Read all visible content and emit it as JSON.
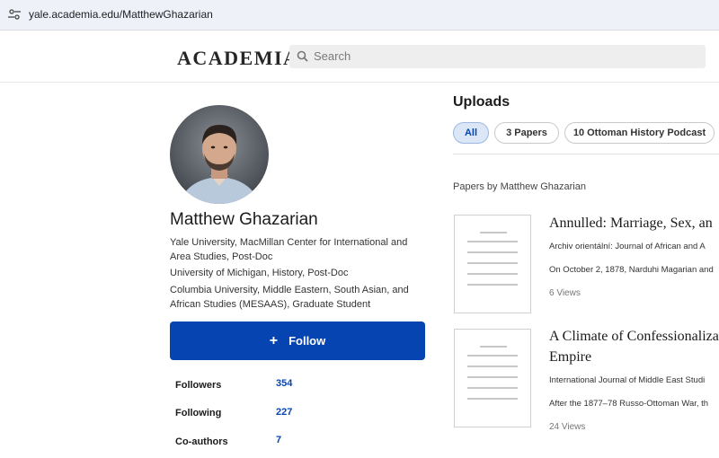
{
  "browser": {
    "url": "yale.academia.edu/MatthewGhazarian"
  },
  "header": {
    "logo": "ACADEMIA",
    "search_placeholder": "Search"
  },
  "profile": {
    "name": "Matthew Ghazarian",
    "affiliations": [
      "Yale University, MacMillan Center for International and Area Studies, Post-Doc",
      "University of Michigan, History, Post-Doc",
      "Columbia University, Middle Eastern, South Asian, and African Studies (MESAAS), Graduate Student"
    ],
    "follow_label": "Follow",
    "stats": [
      {
        "label": "Followers",
        "value": "354"
      },
      {
        "label": "Following",
        "value": "227"
      },
      {
        "label": "Co-authors",
        "value": "7"
      }
    ]
  },
  "uploads": {
    "title": "Uploads",
    "tabs": [
      "All",
      "3 Papers",
      "10 Ottoman History Podcast"
    ],
    "papers_by": "Papers by Matthew Ghazarian",
    "papers": [
      {
        "title_lines": [
          "Annulled: Marriage, Sex, an"
        ],
        "journal": "Archiv orientální: Journal of African and A",
        "snippet": "On October 2, 1878, Narduhi Magarian and",
        "views": "6 Views"
      },
      {
        "title_lines": [
          "A Climate of Confessionaliza",
          "Empire"
        ],
        "journal": "International Journal of Middle East Studi",
        "snippet": "After the 1877–78 Russo-Ottoman War, th",
        "views": "24 Views"
      }
    ]
  },
  "colors": {
    "accent": "#0645b1",
    "chip_active_bg": "#dbe7f7"
  }
}
